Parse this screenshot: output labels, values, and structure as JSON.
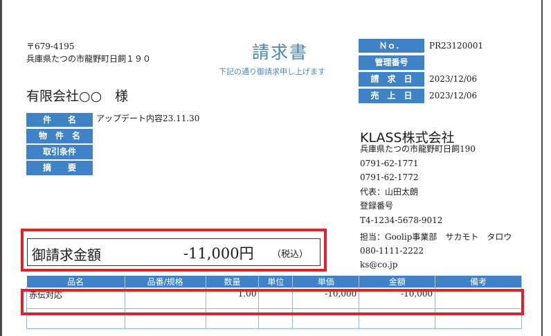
{
  "recipient": {
    "postal": "〒679-4195",
    "address": "兵庫県たつの市龍野町日飼１９０",
    "name": "有限会社○○　様"
  },
  "document": {
    "title": "請求書",
    "subtitle": "下記の通り御請求申し上げます"
  },
  "meta": [
    {
      "label": "Ｎｏ．",
      "value": "PR23120001"
    },
    {
      "label": "管理番号",
      "value": ""
    },
    {
      "label": "請　求　日",
      "value": "2023/12/06"
    },
    {
      "label": "売　上　日",
      "value": "2023/12/06"
    }
  ],
  "details": [
    {
      "label": "件　　名",
      "value": "アップデート内容23.11.30"
    },
    {
      "label": "物　件　名",
      "value": ""
    },
    {
      "label": "取引条件",
      "value": ""
    },
    {
      "label": "摘　　要",
      "value": ""
    }
  ],
  "issuer": {
    "company": "KLASS株式会社",
    "lines": [
      "兵庫県たつの市龍野町日飼190",
      "0791-62-1771",
      "0791-62-1772",
      "代表：山田太朗",
      "登録番号",
      "T4-1234-5678-9012"
    ],
    "contact": [
      "担当：Goolip事業部　サカモト　タロウ",
      "080-1111-2222",
      "ks@co.jp"
    ]
  },
  "total": {
    "label": "御請求金額",
    "amount": "-11,000円",
    "tax": "（税込）"
  },
  "table": {
    "headers": [
      "品名",
      "品番/規格",
      "数量",
      "単位",
      "単価",
      "金額",
      "備考"
    ],
    "rows": [
      [
        "赤伝対応",
        "",
        "1.00",
        "",
        "-10,000",
        "-10,000",
        ""
      ],
      [
        "",
        "",
        "",
        "",
        "",
        "",
        ""
      ]
    ]
  },
  "colors": {
    "accent": "#3f83c6",
    "highlight": "#e0202a"
  }
}
